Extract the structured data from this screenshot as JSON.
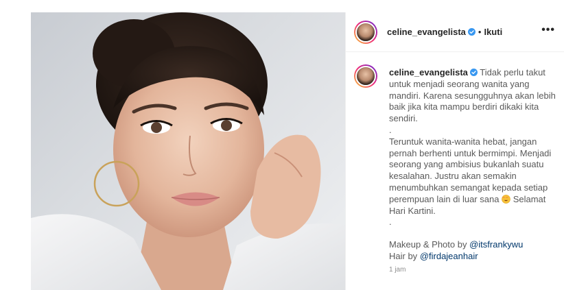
{
  "post": {
    "username": "celine_evangelista",
    "separator": "•",
    "follow_label": "Ikuti",
    "more_label": "•••",
    "caption": {
      "username": "celine_evangelista",
      "lines": [
        "Tidak perlu takut untuk menjadi seorang wanita yang mandiri. Karena sesungguhnya akan lebih baik jika kita mampu berdiri dikaki kita sendiri.",
        ".",
        "Teruntuk wanita-wanita hebat, jangan pernah berhenti untuk bermimpi. Menjadi seorang yang ambisius bukanlah suatu kesalahan. Justru akan semakin menumbuhkan semangat kepada setiap perempuan lain di luar sana",
        "Selamat Hari Kartini.",
        "."
      ],
      "credit_makeup_prefix": "Makeup & Photo by",
      "credit_makeup_handle": "@itsfrankywu",
      "credit_hair_prefix": "Hair by",
      "credit_hair_handle": "@firdajeanhair"
    },
    "time_ago": "1 jam",
    "icons": {
      "verified": "verified-badge-icon",
      "emoji": "smiling-face-with-heart-eyes-emoji",
      "more": "more-options-icon"
    },
    "colors": {
      "verified_blue": "#3897f0",
      "mention": "#00376b",
      "muted": "#8e8e8e"
    }
  }
}
